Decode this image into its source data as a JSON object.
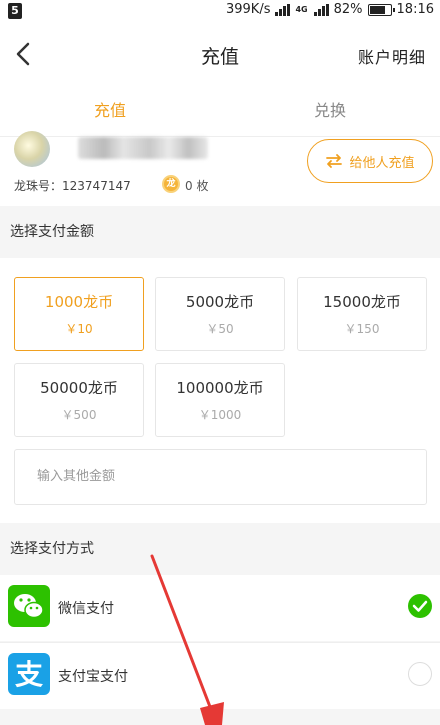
{
  "status_bar": {
    "network_speed": "399K/s",
    "network_type": "4G",
    "battery": "82%",
    "battery_level": 0.82,
    "time": "18:16"
  },
  "header": {
    "title": "充值",
    "account_detail": "账户明细"
  },
  "tabs": [
    {
      "label": "充值",
      "active": true
    },
    {
      "label": "兑换",
      "active": false
    }
  ],
  "user": {
    "dragon_id_label": "龙珠号：",
    "dragon_id": "123747147",
    "coin_count": "0 枚"
  },
  "gift_button": {
    "label": "给他人充值"
  },
  "amount_section": {
    "title": "选择支付金额"
  },
  "amounts": [
    {
      "coins": "1000龙币",
      "price": "￥10",
      "selected": true
    },
    {
      "coins": "5000龙币",
      "price": "￥50",
      "selected": false
    },
    {
      "coins": "15000龙币",
      "price": "￥150",
      "selected": false
    },
    {
      "coins": "50000龙币",
      "price": "￥500",
      "selected": false
    },
    {
      "coins": "100000龙币",
      "price": "￥1000",
      "selected": false
    }
  ],
  "other_amount": {
    "placeholder": "输入其他金额"
  },
  "pay_section": {
    "title": "选择支付方式"
  },
  "payment_methods": [
    {
      "name": "微信支付",
      "icon": "wechat-icon",
      "selected": true
    },
    {
      "name": "支付宝支付",
      "icon": "alipay-icon",
      "selected": false
    }
  ],
  "colors": {
    "accent": "#f0a020",
    "wechat": "#2dc100",
    "alipay": "#1aa1e6",
    "annotation_arrow": "#e53935"
  }
}
